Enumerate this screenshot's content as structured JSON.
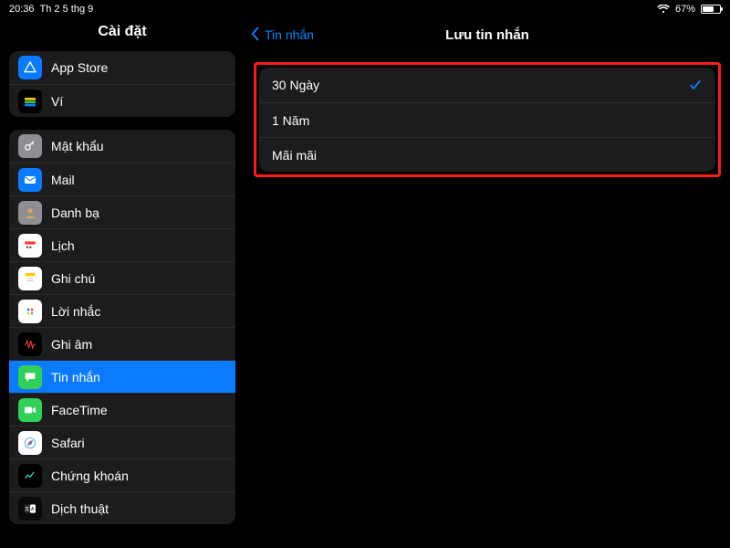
{
  "status": {
    "time": "20:36",
    "date": "Th 2 5 thg 9",
    "battery_text": "67%",
    "battery_level": 67
  },
  "sidebar": {
    "title": "Cài đặt",
    "groups": [
      {
        "items": [
          {
            "id": "app-store",
            "label": "App Store",
            "icon": "appstore",
            "bg": "#0a7aff"
          },
          {
            "id": "wallet",
            "label": "Ví",
            "icon": "wallet",
            "bg": "#000000"
          }
        ]
      },
      {
        "items": [
          {
            "id": "passwords",
            "label": "Mật khẩu",
            "icon": "key",
            "bg": "#8e8e93"
          },
          {
            "id": "mail",
            "label": "Mail",
            "icon": "mail",
            "bg": "#0a7aff"
          },
          {
            "id": "contacts",
            "label": "Danh bạ",
            "icon": "contacts",
            "bg": "#8e8e93"
          },
          {
            "id": "calendar",
            "label": "Lịch",
            "icon": "calendar",
            "bg": "#ffffff"
          },
          {
            "id": "notes",
            "label": "Ghi chú",
            "icon": "notes",
            "bg": "#ffffff"
          },
          {
            "id": "reminders",
            "label": "Lời nhắc",
            "icon": "reminders",
            "bg": "#ffffff"
          },
          {
            "id": "voicememo",
            "label": "Ghi âm",
            "icon": "voice",
            "bg": "#000000"
          },
          {
            "id": "messages",
            "label": "Tin nhắn",
            "icon": "messages",
            "bg": "#30d158",
            "selected": true
          },
          {
            "id": "facetime",
            "label": "FaceTime",
            "icon": "facetime",
            "bg": "#30d158"
          },
          {
            "id": "safari",
            "label": "Safari",
            "icon": "safari",
            "bg": "#ffffff"
          },
          {
            "id": "stocks",
            "label": "Chứng khoán",
            "icon": "stocks",
            "bg": "#000000"
          },
          {
            "id": "translate",
            "label": "Dịch thuật",
            "icon": "translate",
            "bg": "#0a0a0a"
          }
        ]
      }
    ]
  },
  "detail": {
    "back_label": "Tin nhắn",
    "title": "Lưu tin nhắn",
    "options": [
      {
        "label": "30 Ngày",
        "selected": true
      },
      {
        "label": "1 Năm",
        "selected": false
      },
      {
        "label": "Mãi mãi",
        "selected": false
      }
    ]
  }
}
